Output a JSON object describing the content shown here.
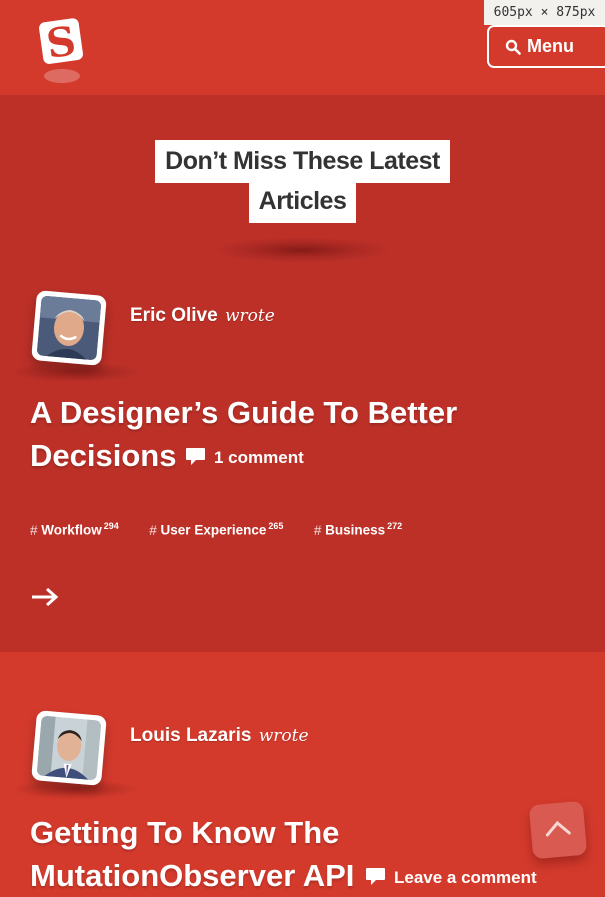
{
  "viewport_badge": "605px × 875px",
  "header": {
    "logo_letter": "S",
    "menu_label": "Menu",
    "menu_icon": "search-icon"
  },
  "section_heading": {
    "line1": "Don’t Miss These Latest",
    "line2": "Articles"
  },
  "articles": [
    {
      "author": "Eric Olive",
      "wrote": "wrote",
      "title_line1": "A Designer’s Guide To Better",
      "title_line2": "Decisions",
      "comments": "1 comment",
      "tags": [
        {
          "hash": "#",
          "name": "Workflow",
          "count": "294"
        },
        {
          "hash": "#",
          "name": "User Experience",
          "count": "265"
        },
        {
          "hash": "#",
          "name": "Business",
          "count": "272"
        }
      ],
      "read_more_icon": "arrow-right-icon"
    },
    {
      "author": "Louis Lazaris",
      "wrote": "wrote",
      "title_line1": "Getting To Know The",
      "title_line2": "MutationObserver API",
      "comments": "Leave a comment"
    }
  ],
  "colors": {
    "header_bg": "#d33a2c",
    "section_dark_bg": "#bc3028",
    "section_light_bg": "#d33a2c",
    "heading_box": "#ffffff",
    "heading_text": "#333333"
  },
  "back_to_top_icon": "chevron-up-icon"
}
